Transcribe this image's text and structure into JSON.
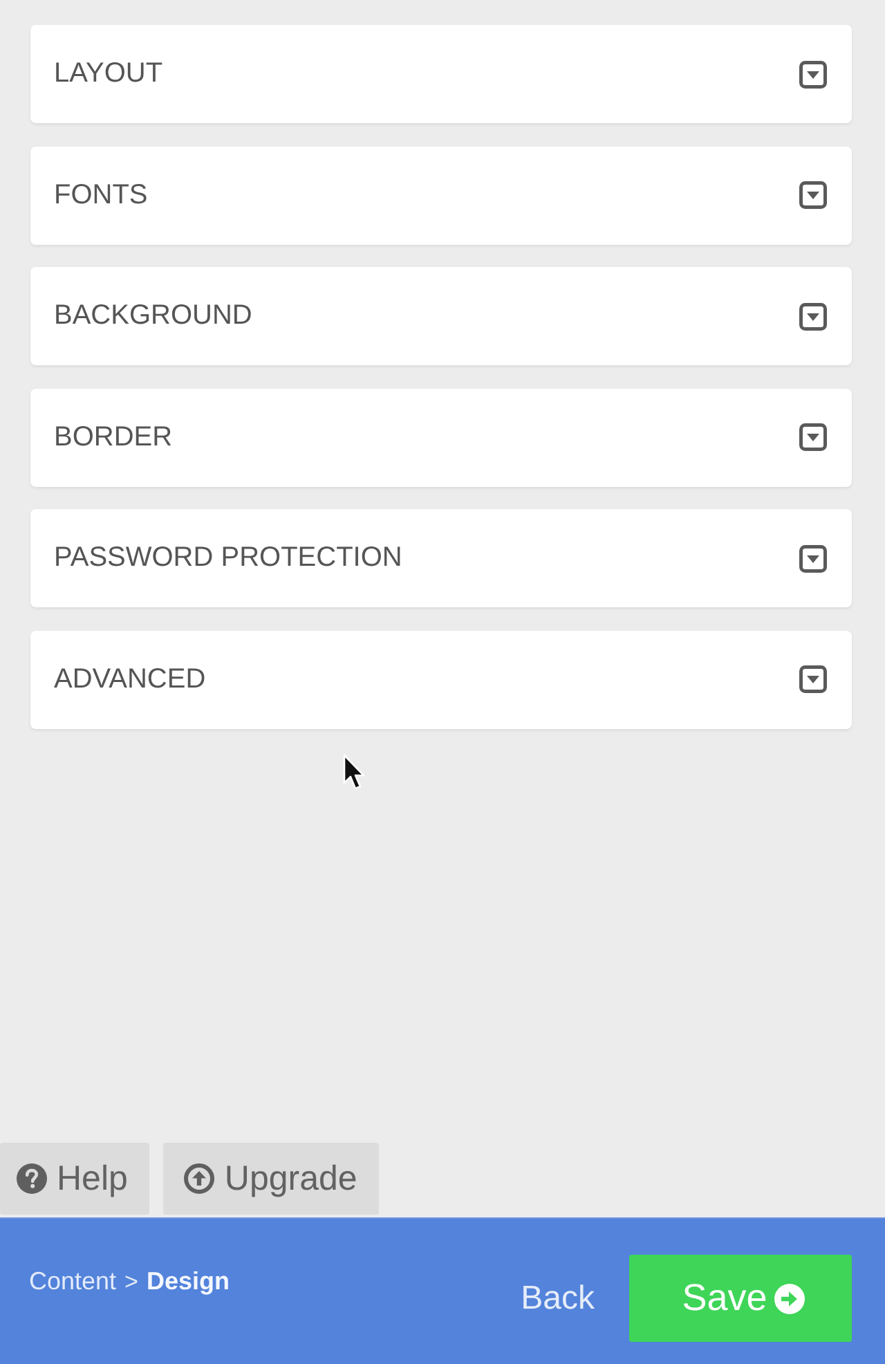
{
  "sections": [
    {
      "title": "LAYOUT",
      "expanded": false
    },
    {
      "title": "FONTS",
      "expanded": false
    },
    {
      "title": "BACKGROUND",
      "expanded": false
    },
    {
      "title": "BORDER",
      "expanded": false
    },
    {
      "title": "PASSWORD PROTECTION",
      "expanded": false
    },
    {
      "title": "ADVANCED",
      "expanded": false
    }
  ],
  "help_buttons": [
    {
      "kind": "help",
      "label": "Help"
    },
    {
      "kind": "upgrade",
      "label": "Upgrade"
    }
  ],
  "footer": {
    "breadcrumb": {
      "items": [
        {
          "label": "Content",
          "selected": false
        },
        {
          "label": "Design",
          "selected": true
        }
      ],
      "separator": ">"
    },
    "back": "Back",
    "save": "Save"
  }
}
